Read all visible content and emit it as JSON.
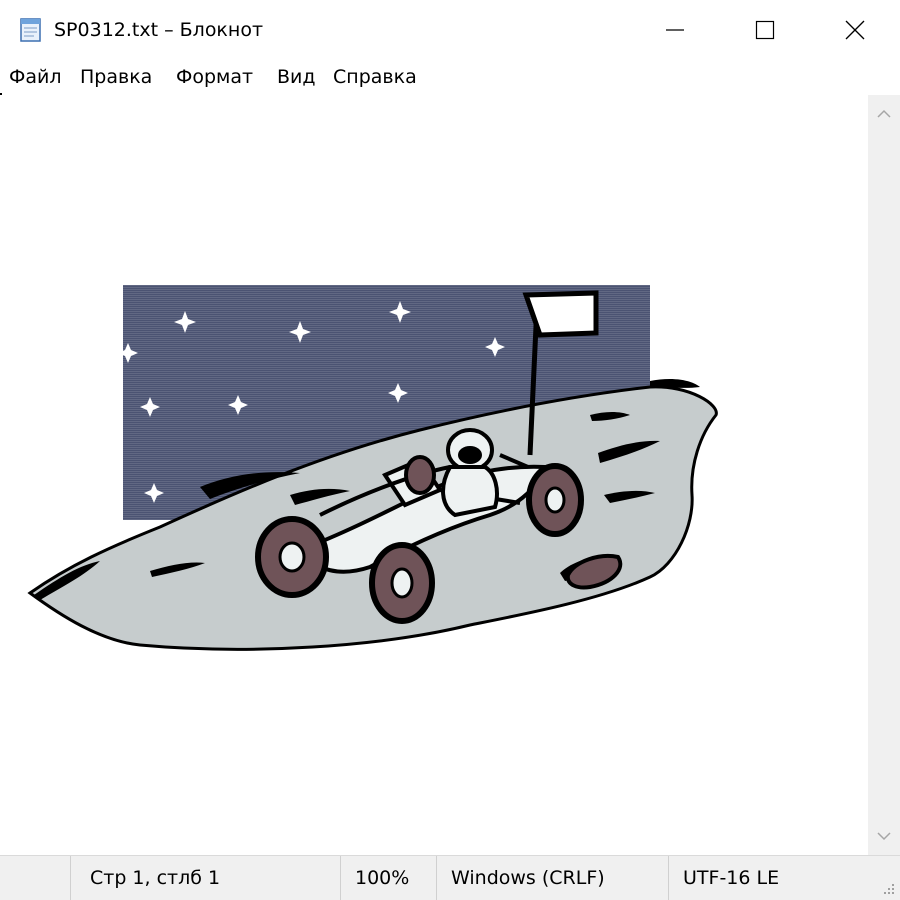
{
  "window": {
    "title": "SP0312.txt – Блокнот",
    "icon": "notepad-icon",
    "controls": [
      "minimize-icon",
      "maximize-icon",
      "close-icon"
    ]
  },
  "menu": {
    "items": [
      "Файл",
      "Правка",
      "Формат",
      "Вид",
      "Справка"
    ]
  },
  "editor": {
    "content_type": "ascii-art-image",
    "scene": "lunar-rover-on-moon-surface-with-flag-and-stars",
    "colors": {
      "sky": "#4b5372",
      "ground": "#c6cccd",
      "ink": "#000000",
      "wheel": "#6f5358",
      "star": "#ffffff"
    }
  },
  "scrollbar": {
    "up_icon": "chevron-up-icon",
    "down_icon": "chevron-down-icon"
  },
  "status": {
    "position": "Стр 1, стлб 1",
    "zoom": "100%",
    "line_endings": "Windows (CRLF)",
    "encoding": "UTF-16 LE"
  }
}
